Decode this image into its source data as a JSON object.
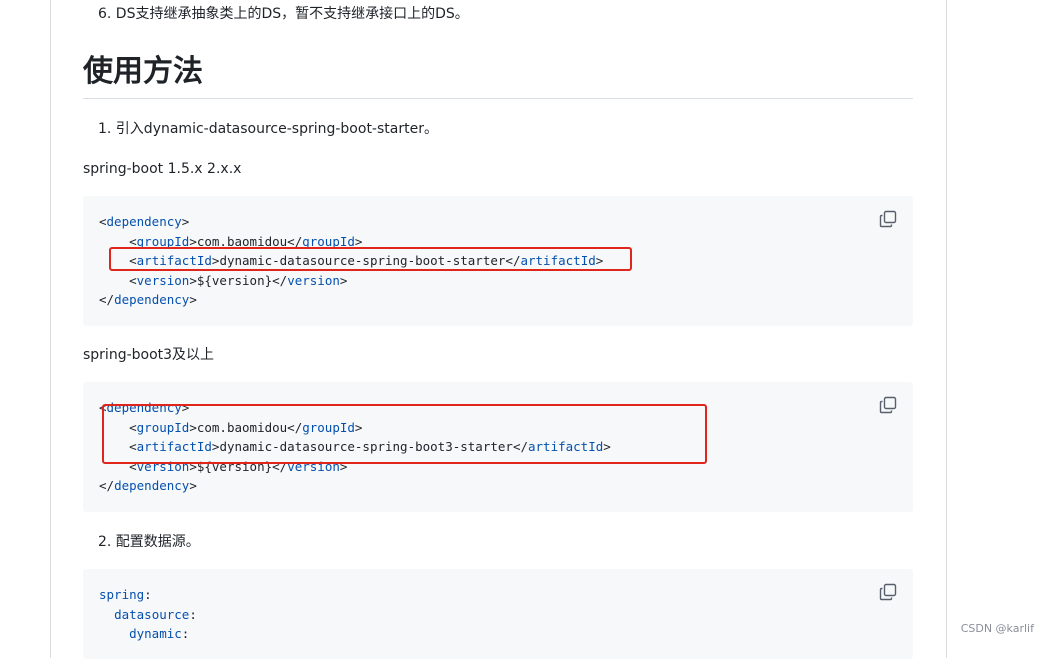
{
  "list": {
    "item6": "6. DS支持继承抽象类上的DS，暂不支持继承接口上的DS。",
    "item1": "1. 引入dynamic-datasource-spring-boot-starter。",
    "item2": "2. 配置数据源。"
  },
  "heading": {
    "usage": "使用方法"
  },
  "paragraphs": {
    "sb15": "spring-boot 1.5.x 2.x.x",
    "sb3": "spring-boot3及以上"
  },
  "code1": {
    "dep_open_tag": "dependency",
    "group_tag": "groupId",
    "group_value": "com.baomidou",
    "artifact_tag": "artifactId",
    "artifact_value": "dynamic-datasource-spring-boot-starter",
    "version_tag": "version",
    "version_value": "${version}"
  },
  "code2": {
    "dep_open_tag": "dependency",
    "group_tag": "groupId",
    "group_value": "com.baomidou",
    "artifact_tag": "artifactId",
    "artifact_value": "dynamic-datasource-spring-boot3-starter",
    "version_tag": "version",
    "version_value": "${version}"
  },
  "code3": {
    "line1_key": "spring",
    "line2_key": "datasource",
    "line3_key": "dynamic"
  },
  "icons": {
    "copy": "copy-icon"
  },
  "colors": {
    "highlight": "#e0251d",
    "tag": "#0550ae",
    "code_bg": "#f6f8fa"
  },
  "watermark": "CSDN @karlif"
}
